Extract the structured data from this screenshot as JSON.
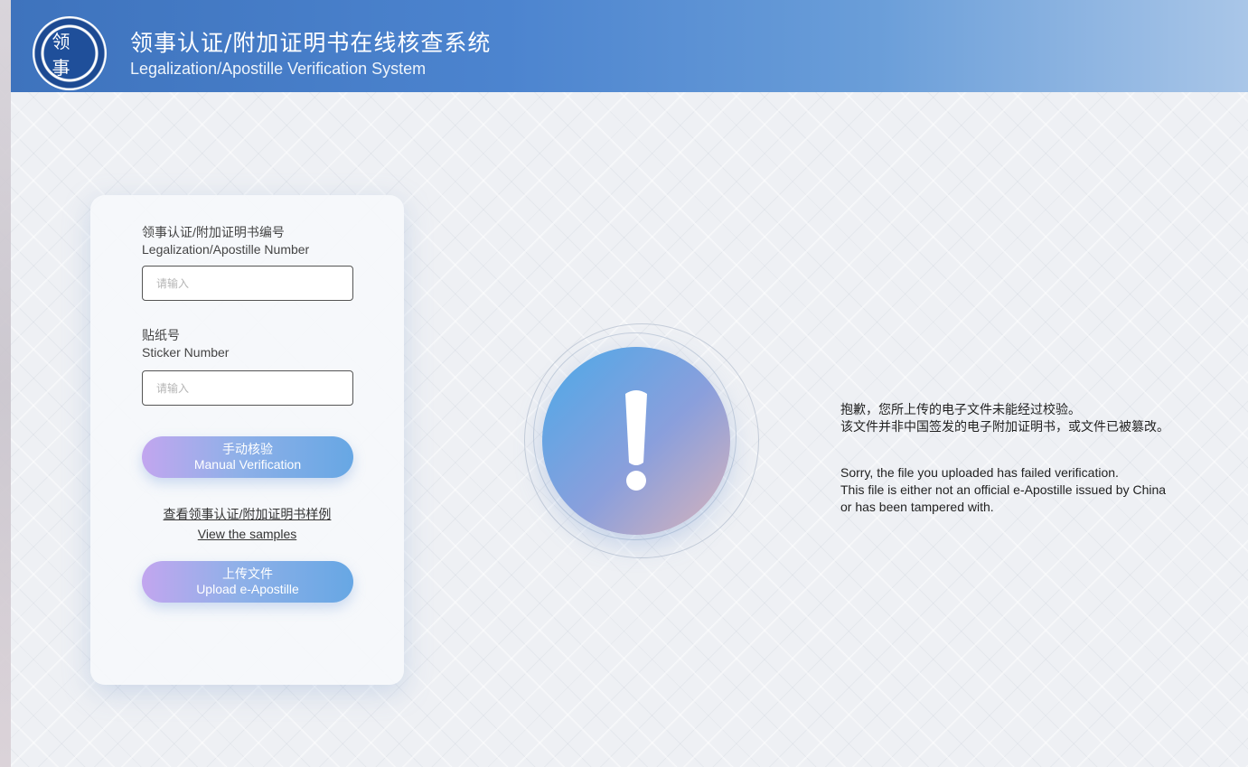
{
  "header": {
    "title_cn": "领事认证/附加证明书在线核查系统",
    "title_en": "Legalization/Apostille Verification System",
    "logo_icon": "consular-affairs-seal-icon",
    "logo_text": "领事"
  },
  "form": {
    "number_label_cn": "领事认证/附加证明书编号",
    "number_label_en": "Legalization/Apostille Number",
    "number_placeholder": "请输入",
    "number_value": "",
    "sticker_label_cn": "贴纸号",
    "sticker_label_en": "Sticker Number",
    "sticker_placeholder": "请输入",
    "sticker_value": "",
    "manual_button_cn": "手动核验",
    "manual_button_en": "Manual Verification",
    "samples_link_cn": "查看领事认证/附加证明书样例",
    "samples_link_en": "View the samples",
    "upload_button_cn": "上传文件",
    "upload_button_en": "Upload e-Apostille"
  },
  "result": {
    "status_icon": "exclamation-icon",
    "message_cn_line1": "抱歉，您所上传的电子文件未能经过校验。",
    "message_cn_line2": "该文件并非中国签发的电子附加证明书，或文件已被篡改。",
    "message_en_line1": "Sorry, the file you uploaded has failed verification.",
    "message_en_line2": "This file is either not an official e-Apostille issued by China",
    "message_en_line3": "or has been tampered with."
  },
  "colors": {
    "header_blue": "#3e73bd",
    "button_gradient_start": "#c2a6ef",
    "button_gradient_end": "#67a7e4",
    "alert_gradient_start": "#4da9e8",
    "alert_gradient_end": "#d9b3ba"
  }
}
